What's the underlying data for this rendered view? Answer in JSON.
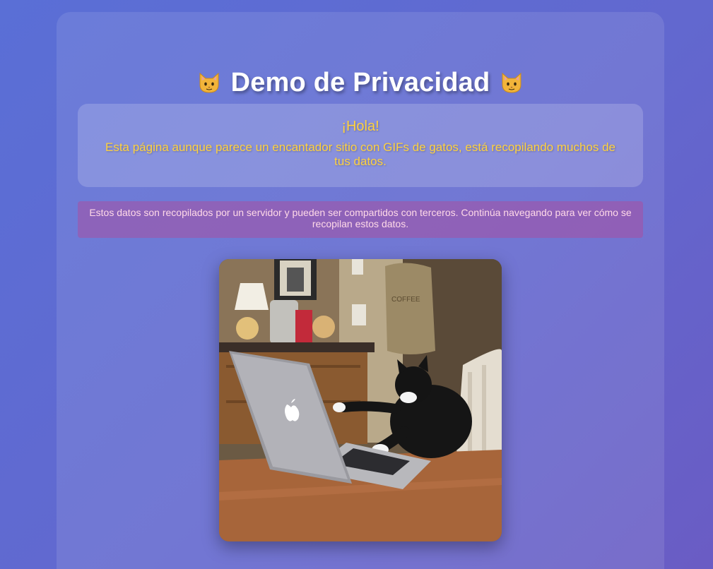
{
  "header": {
    "title": "Demo de Privacidad",
    "left_icon": "cat-face-icon",
    "right_icon": "cat-face-icon"
  },
  "intro": {
    "greeting": "¡Hola!",
    "message": "Esta página aunque parece un encantador sitio con GIFs de gatos, está recopilando muchos de tus datos."
  },
  "warning": {
    "text": "Estos datos son recopilados por un servidor y pueden ser compartidos con terceros. Continúa navegando para ver cómo se recopilan estos datos."
  },
  "gif": {
    "subject": "cat typing on laptop"
  },
  "colors": {
    "background": "#5f6ad3",
    "title": "#ffffff",
    "greeting": "#ffd23f",
    "warning_text": "#ffd9e8"
  }
}
